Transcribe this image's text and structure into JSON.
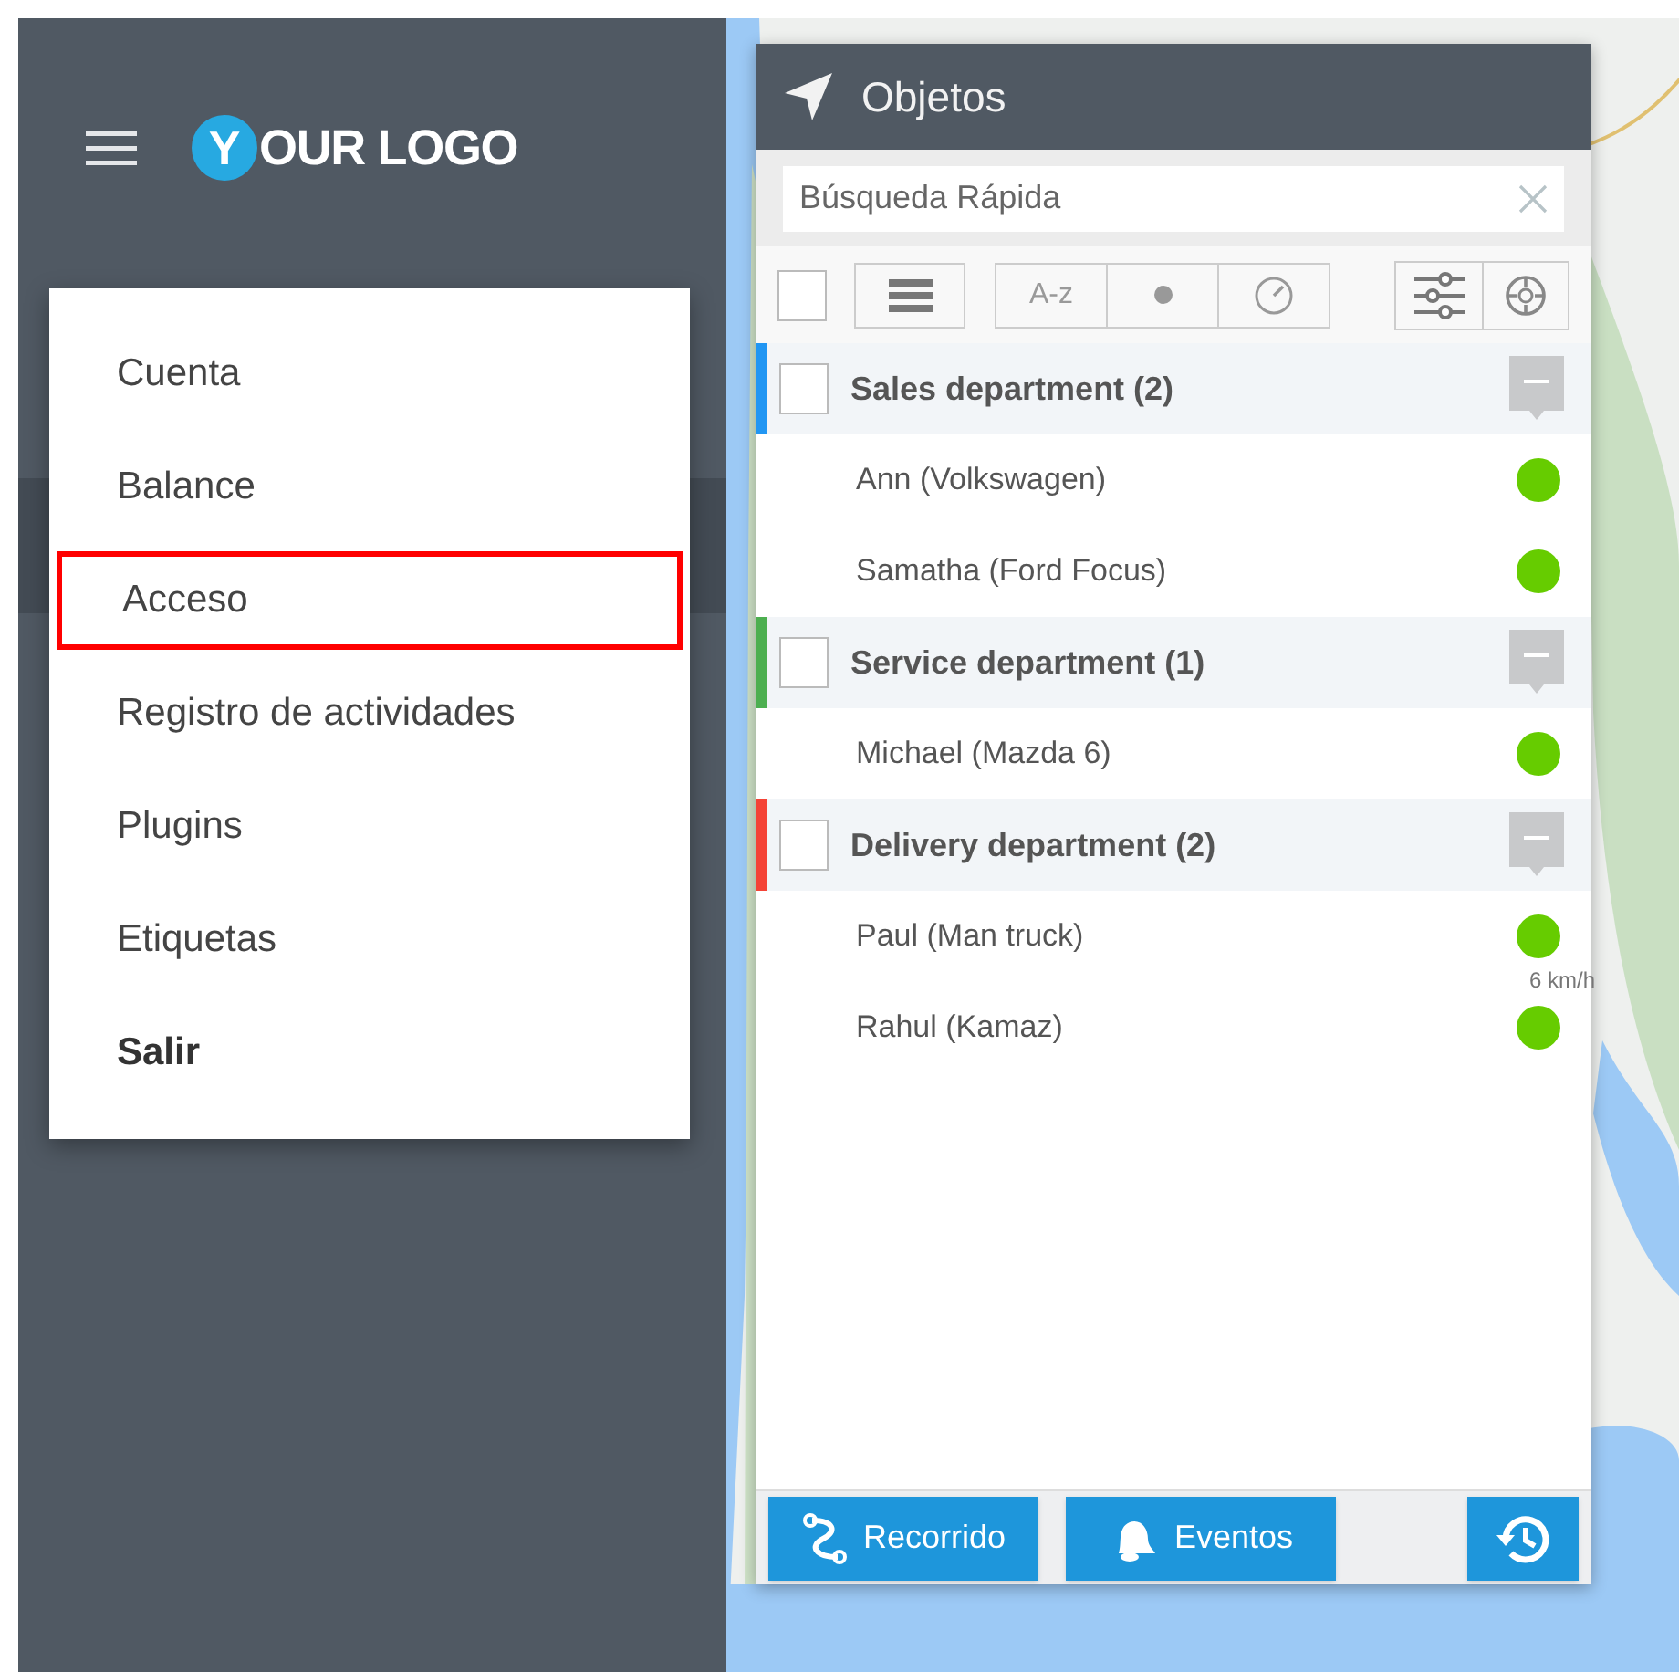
{
  "logo": {
    "badge": "Y",
    "text": "OUR LOGO"
  },
  "menu": [
    {
      "label": "Cuenta",
      "kind": "link",
      "selected": false
    },
    {
      "label": "Balance",
      "kind": "link",
      "selected": false
    },
    {
      "label": "Acceso",
      "kind": "link",
      "selected": true
    },
    {
      "label": "Registro de actividades",
      "kind": "link",
      "selected": false
    },
    {
      "label": "Plugins",
      "kind": "link",
      "selected": false
    },
    {
      "label": "Etiquetas",
      "kind": "link",
      "selected": false
    },
    {
      "label": "Salir",
      "kind": "logout",
      "selected": false
    }
  ],
  "panel": {
    "title": "Objetos",
    "search": {
      "placeholder": "Búsqueda Rápida"
    },
    "toolbar": {
      "select_all_checked": false,
      "sort_label": "A-z"
    },
    "groups": [
      {
        "name": "Sales department (2)",
        "color": "#2196f3",
        "checked": false,
        "expanded": true,
        "objects": [
          {
            "name": "Ann (Volkswagen)"
          },
          {
            "name": "Samatha (Ford Focus)"
          }
        ]
      },
      {
        "name": "Service department (1)",
        "color": "#4caf50",
        "checked": false,
        "expanded": true,
        "objects": [
          {
            "name": "Michael (Mazda 6)"
          }
        ]
      },
      {
        "name": "Delivery department (2)",
        "color": "#f44336",
        "checked": false,
        "expanded": true,
        "objects": [
          {
            "name": "Paul (Man truck)",
            "speed": "6 km/h"
          },
          {
            "name": "Rahul (Kamaz)"
          }
        ]
      }
    ],
    "buttons": [
      {
        "label": "Recorrido",
        "kind": "track"
      },
      {
        "label": "Eventos",
        "kind": "events"
      },
      {
        "kind": "history"
      }
    ]
  }
}
